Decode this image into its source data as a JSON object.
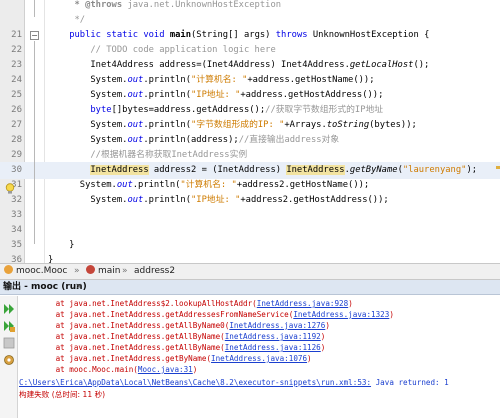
{
  "editor": {
    "lines": [
      {
        "n": "",
        "t": "     * @throws java.net.UnknownHostException"
      },
      {
        "n": "",
        "t": "     */"
      },
      {
        "n": "21",
        "t": "    public static void main(String[] args) throws UnknownHostException {"
      },
      {
        "n": "22",
        "t": "        // TODO code application logic here"
      },
      {
        "n": "23",
        "t": "        Inet4Address address=(Inet4Address) Inet4Address.getLocalHost();"
      },
      {
        "n": "24",
        "t": "        System.out.println(\"计算机名: \"+address.getHostName());"
      },
      {
        "n": "25",
        "t": "        System.out.println(\"IP地址: \"+address.getHostAddress());"
      },
      {
        "n": "26",
        "t": "        byte[]bytes=address.getAddress();//获取字节数组形式的IP地址"
      },
      {
        "n": "27",
        "t": "        System.out.println(\"字节数组形成的IP: \"+Arrays.toString(bytes));"
      },
      {
        "n": "28",
        "t": "        System.out.println(address);//直接输出address对象"
      },
      {
        "n": "29",
        "t": "        //根据机器名称获取InetAddress实例"
      },
      {
        "n": "30",
        "t": "        InetAddress address2 = (InetAddress) InetAddress.getByName(\"laurenyang\");"
      },
      {
        "n": "31",
        "t": "      System.out.println(\"计算机名: \"+address2.getHostName());"
      },
      {
        "n": "32",
        "t": "        System.out.println(\"IP地址: \"+address2.getHostAddress());"
      },
      {
        "n": "33",
        "t": ""
      },
      {
        "n": "34",
        "t": ""
      },
      {
        "n": "35",
        "t": "    }"
      },
      {
        "n": "36",
        "t": "}"
      }
    ]
  },
  "breadcrumb": {
    "items": [
      "mooc.Mooc",
      "main",
      "address2"
    ],
    "separator": "»"
  },
  "output": {
    "title": "输出 - mooc (run)",
    "close": "×",
    "lines": [
      {
        "pre": "        at java.net.InetAddress$2.lookupAllHostAddr(",
        "link": "InetAddress.java:928",
        "post": ")"
      },
      {
        "pre": "        at java.net.InetAddress.getAddressesFromNameService(",
        "link": "InetAddress.java:1323",
        "post": ")"
      },
      {
        "pre": "        at java.net.InetAddress.getAllByName0(",
        "link": "InetAddress.java:1276",
        "post": ")"
      },
      {
        "pre": "        at java.net.InetAddress.getAllByName(",
        "link": "InetAddress.java:1192",
        "post": ")"
      },
      {
        "pre": "        at java.net.InetAddress.getAllByName(",
        "link": "InetAddress.java:1126",
        "post": ")"
      },
      {
        "pre": "        at java.net.InetAddress.getByName(",
        "link": "InetAddress.java:1076",
        "post": ")"
      },
      {
        "pre": "        at mooc.Mooc.main(",
        "link": "Mooc.java:31",
        "post": ")"
      }
    ],
    "path_link": "C:\\Users\\Erica\\AppData\\Local\\NetBeans\\Cache\\8.2\\executor-snippets\\run.xml:53:",
    "path_rest": " Java returned: 1",
    "build_failed": "构建失败 (总时间: 11 秒)"
  },
  "icons": {
    "rerun": "rerun-icon",
    "rerun_with_options": "rerun-options-icon",
    "stop": "stop-icon",
    "settings": "settings-icon",
    "lightbulb": "lightbulb-warning-icon"
  },
  "colors": {
    "keyword": "#0000e6",
    "comment": "#969696",
    "string": "#ce7b00",
    "error_text": "#c40000",
    "link": "#1a3fcf",
    "highlight": "#f2e3a0",
    "output_header": "#dde6f2"
  }
}
